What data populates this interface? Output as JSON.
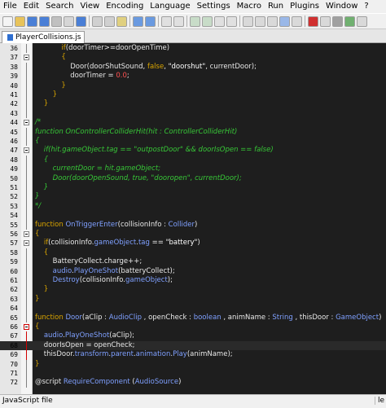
{
  "menu": [
    "File",
    "Edit",
    "Search",
    "View",
    "Encoding",
    "Language",
    "Settings",
    "Macro",
    "Run",
    "Plugins",
    "Window",
    "?"
  ],
  "tab": {
    "label": "PlayerCollisions.js"
  },
  "status": {
    "file_type": "JavaScript file",
    "right": "le"
  },
  "colors": {
    "default": "#e8e8e8",
    "keyword": "#d9a400",
    "comment": "#37c737",
    "string": "#ffffff",
    "number": "#ff5050",
    "type": "#7fa0ff",
    "method": "#7fa0ff"
  },
  "lines": [
    {
      "n": "36",
      "segs": [
        [
          "            ",
          "default"
        ],
        [
          "if",
          "keyword"
        ],
        [
          "(doorTimer>=doorOpenTime)",
          "default"
        ]
      ]
    },
    {
      "n": "37",
      "segs": [
        [
          "            {",
          "keyword"
        ]
      ]
    },
    {
      "n": "38",
      "segs": [
        [
          "                Door(doorShutSound, ",
          "default"
        ],
        [
          "false",
          "keyword"
        ],
        [
          ", ",
          "default"
        ],
        [
          "\"doorshut\"",
          "string"
        ],
        [
          ", currentDoor);",
          "default"
        ]
      ]
    },
    {
      "n": "39",
      "segs": [
        [
          "                doorTimer = ",
          "default"
        ],
        [
          "0.0",
          "number"
        ],
        [
          ";",
          "default"
        ]
      ]
    },
    {
      "n": "40",
      "segs": [
        [
          "            }",
          "keyword"
        ]
      ]
    },
    {
      "n": "41",
      "segs": [
        [
          "        }",
          "keyword"
        ]
      ]
    },
    {
      "n": "42",
      "segs": [
        [
          "    }",
          "keyword"
        ]
      ]
    },
    {
      "n": "43",
      "segs": []
    },
    {
      "n": "44",
      "segs": [
        [
          "/*",
          "comment"
        ]
      ]
    },
    {
      "n": "45",
      "segs": [
        [
          "function OnControllerColliderHit(hit : ControllerColliderHit)",
          "comment"
        ]
      ]
    },
    {
      "n": "46",
      "segs": [
        [
          "{",
          "comment"
        ]
      ]
    },
    {
      "n": "47",
      "segs": [
        [
          "    if(hit.gameObject.tag == \"outpostDoor\" && doorIsOpen == false)",
          "comment"
        ]
      ]
    },
    {
      "n": "48",
      "segs": [
        [
          "    {",
          "comment"
        ]
      ]
    },
    {
      "n": "49",
      "segs": [
        [
          "        currentDoor = hit.gameObject;",
          "comment"
        ]
      ]
    },
    {
      "n": "50",
      "segs": [
        [
          "        Door(doorOpenSound, true, \"dooropen\", currentDoor);",
          "comment"
        ]
      ]
    },
    {
      "n": "51",
      "segs": [
        [
          "    }",
          "comment"
        ]
      ]
    },
    {
      "n": "52",
      "segs": [
        [
          "}",
          "comment"
        ]
      ]
    },
    {
      "n": "53",
      "segs": [
        [
          "*/",
          "comment"
        ]
      ]
    },
    {
      "n": "54",
      "segs": []
    },
    {
      "n": "55",
      "segs": [
        [
          "function ",
          "keyword"
        ],
        [
          "OnTriggerEnter",
          "method"
        ],
        [
          "(collisionInfo : ",
          "default"
        ],
        [
          "Collider",
          "type"
        ],
        [
          ")",
          "default"
        ]
      ]
    },
    {
      "n": "56",
      "segs": [
        [
          "{",
          "keyword"
        ]
      ]
    },
    {
      "n": "57",
      "segs": [
        [
          "    ",
          "default"
        ],
        [
          "if",
          "keyword"
        ],
        [
          "(collisionInfo.",
          "default"
        ],
        [
          "gameObject",
          "method"
        ],
        [
          ".",
          "default"
        ],
        [
          "tag",
          "method"
        ],
        [
          " == ",
          "default"
        ],
        [
          "\"battery\"",
          "string"
        ],
        [
          ")",
          "default"
        ]
      ]
    },
    {
      "n": "58",
      "segs": [
        [
          "    {",
          "keyword"
        ]
      ]
    },
    {
      "n": "59",
      "segs": [
        [
          "        BatteryCollect.charge++;",
          "default"
        ]
      ]
    },
    {
      "n": "60",
      "segs": [
        [
          "        ",
          "default"
        ],
        [
          "audio",
          "method"
        ],
        [
          ".",
          "default"
        ],
        [
          "PlayOneShot",
          "method"
        ],
        [
          "(batteryCollect);",
          "default"
        ]
      ]
    },
    {
      "n": "61",
      "segs": [
        [
          "        ",
          "default"
        ],
        [
          "Destroy",
          "method"
        ],
        [
          "(collisionInfo.",
          "default"
        ],
        [
          "gameObject",
          "method"
        ],
        [
          ");",
          "default"
        ]
      ]
    },
    {
      "n": "62",
      "segs": [
        [
          "    }",
          "keyword"
        ]
      ]
    },
    {
      "n": "63",
      "segs": [
        [
          "}",
          "keyword"
        ]
      ]
    },
    {
      "n": "64",
      "segs": []
    },
    {
      "n": "65",
      "segs": [
        [
          "function ",
          "keyword"
        ],
        [
          "Door",
          "method"
        ],
        [
          "(aClip : ",
          "default"
        ],
        [
          "AudioClip",
          "type"
        ],
        [
          " , openCheck : ",
          "default"
        ],
        [
          "boolean",
          "type"
        ],
        [
          " , animName : ",
          "default"
        ],
        [
          "String",
          "type"
        ],
        [
          " , thisDoor : ",
          "default"
        ],
        [
          "GameObject",
          "type"
        ],
        [
          ")",
          "default"
        ]
      ]
    },
    {
      "n": "66",
      "segs": [
        [
          "{",
          "keyword"
        ]
      ]
    },
    {
      "n": "67",
      "segs": [
        [
          "    ",
          "default"
        ],
        [
          "audio",
          "method"
        ],
        [
          ".",
          "default"
        ],
        [
          "PlayOneShot",
          "method"
        ],
        [
          "(aClip);",
          "default"
        ]
      ]
    },
    {
      "n": "68",
      "segs": [
        [
          "    doorIsOpen = openCheck;",
          "default"
        ]
      ],
      "current": true
    },
    {
      "n": "69",
      "segs": [
        [
          "    thisDoor.",
          "default"
        ],
        [
          "transform",
          "method"
        ],
        [
          ".",
          "default"
        ],
        [
          "parent",
          "method"
        ],
        [
          ".",
          "default"
        ],
        [
          "animation",
          "method"
        ],
        [
          ".",
          "default"
        ],
        [
          "Play",
          "method"
        ],
        [
          "(animName);",
          "default"
        ]
      ]
    },
    {
      "n": "70",
      "segs": [
        [
          "}",
          "keyword"
        ]
      ]
    },
    {
      "n": "71",
      "segs": []
    },
    {
      "n": "72",
      "segs": [
        [
          "@script ",
          "default"
        ],
        [
          "RequireComponent",
          "method"
        ],
        [
          " (",
          "default"
        ],
        [
          "AudioSource",
          "type"
        ],
        [
          ")",
          "default"
        ]
      ]
    }
  ]
}
